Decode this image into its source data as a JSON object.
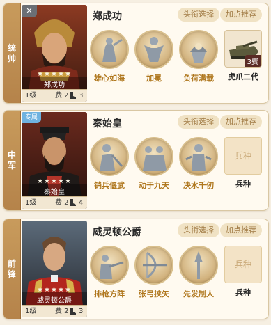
{
  "cards": [
    {
      "position": "统\n帅",
      "name": "郑成功",
      "portrait_name": "郑成功",
      "stars": "★★★★★",
      "level": "1级",
      "cost": "费 2",
      "step": "3",
      "corner": "✕",
      "buttons": {
        "title_select": "头衔选择",
        "points_recommend": "加点推荐"
      },
      "skills": [
        "雄心如海",
        "加冕",
        "负荷满载"
      ],
      "troop": {
        "label": "虎爪二代",
        "cost_tag": "3费"
      }
    },
    {
      "position": "中\n军",
      "name": "秦始皇",
      "portrait_name": "秦始皇",
      "stars": "★★★★★",
      "level": "1级",
      "cost": "费 2",
      "step": "4",
      "tag": "专属",
      "buttons": {
        "title_select": "头衔选择",
        "points_recommend": "加点推荐"
      },
      "skills": [
        "销兵偃武",
        "动于九天",
        "决水千仞"
      ],
      "troop": {
        "label": "兵种",
        "placeholder": "兵种"
      }
    },
    {
      "position": "前\n锋",
      "name": "威灵顿公爵",
      "portrait_name": "威灵顿公爵",
      "stars": "★★★★★",
      "level": "1级",
      "cost": "费 2",
      "step": "3",
      "buttons": {
        "title_select": "头衔选择",
        "points_recommend": "加点推荐"
      },
      "skills": [
        "排枪方阵",
        "张弓挟矢",
        "先发制人"
      ],
      "troop": {
        "label": "兵种",
        "placeholder": "兵种"
      }
    }
  ],
  "colors": {
    "accent_side": "#c89b5c",
    "skill_label": "#b0781f",
    "pill_text": "#a07a43"
  }
}
